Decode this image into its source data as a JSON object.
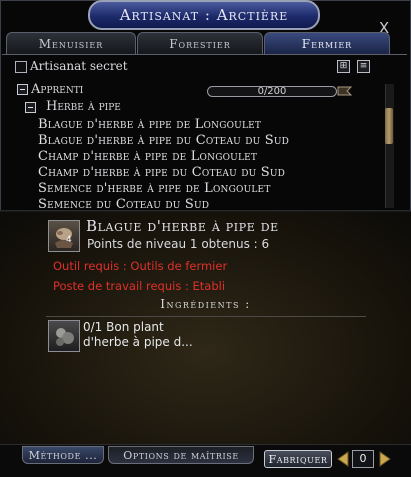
{
  "window": {
    "title": "Artisanat : Arctière",
    "close_glyph": "X"
  },
  "tabs": [
    {
      "label": "Menuisier",
      "active": false
    },
    {
      "label": "Forestier",
      "active": false
    },
    {
      "label": "Fermier",
      "active": true
    }
  ],
  "options": {
    "secret_label": "Artisanat secret",
    "secret_checked": false
  },
  "tier": {
    "label": "Apprenti",
    "progress_text": "0/200",
    "progress_fraction": 0.0
  },
  "category": {
    "label": "Herbe à pipe"
  },
  "recipes": [
    "Blague d'herbe à pipe de Longoulet",
    "Blague d'herbe à pipe du Coteau du Sud",
    "Champ d'herbe à pipe de Longoulet",
    "Champ d'herbe à pipe du Coteau du Sud",
    "Semence d'herbe à pipe de Longoulet",
    "Semence du Coteau du Sud"
  ],
  "detail": {
    "title": "Blague d'herbe à pipe de",
    "icon_count": "4",
    "points_text": "Points de niveau 1 obtenus : 6",
    "tool_required": "Outil requis : Outils de fermier",
    "station_required": "Poste de travail requis : Etabli",
    "ingredients_label": "Ingrédients :",
    "ingredient_text": "0/1 Bon plant\nd'herbe à pipe d..."
  },
  "bottom": {
    "method_tab": "Méthode ...",
    "mastery_tab": "Options de maîtrise",
    "craft_button": "Fabriquer",
    "quantity": "0"
  },
  "colors": {
    "title_bar": "#1d2a6b",
    "requirement_text": "#e0302a",
    "accent_gold": "#b79c6a"
  },
  "icons": [
    "close-icon",
    "collapse-all-icon",
    "expand-all-icon",
    "expand-icon",
    "arrow-left-icon",
    "arrow-right-icon"
  ]
}
